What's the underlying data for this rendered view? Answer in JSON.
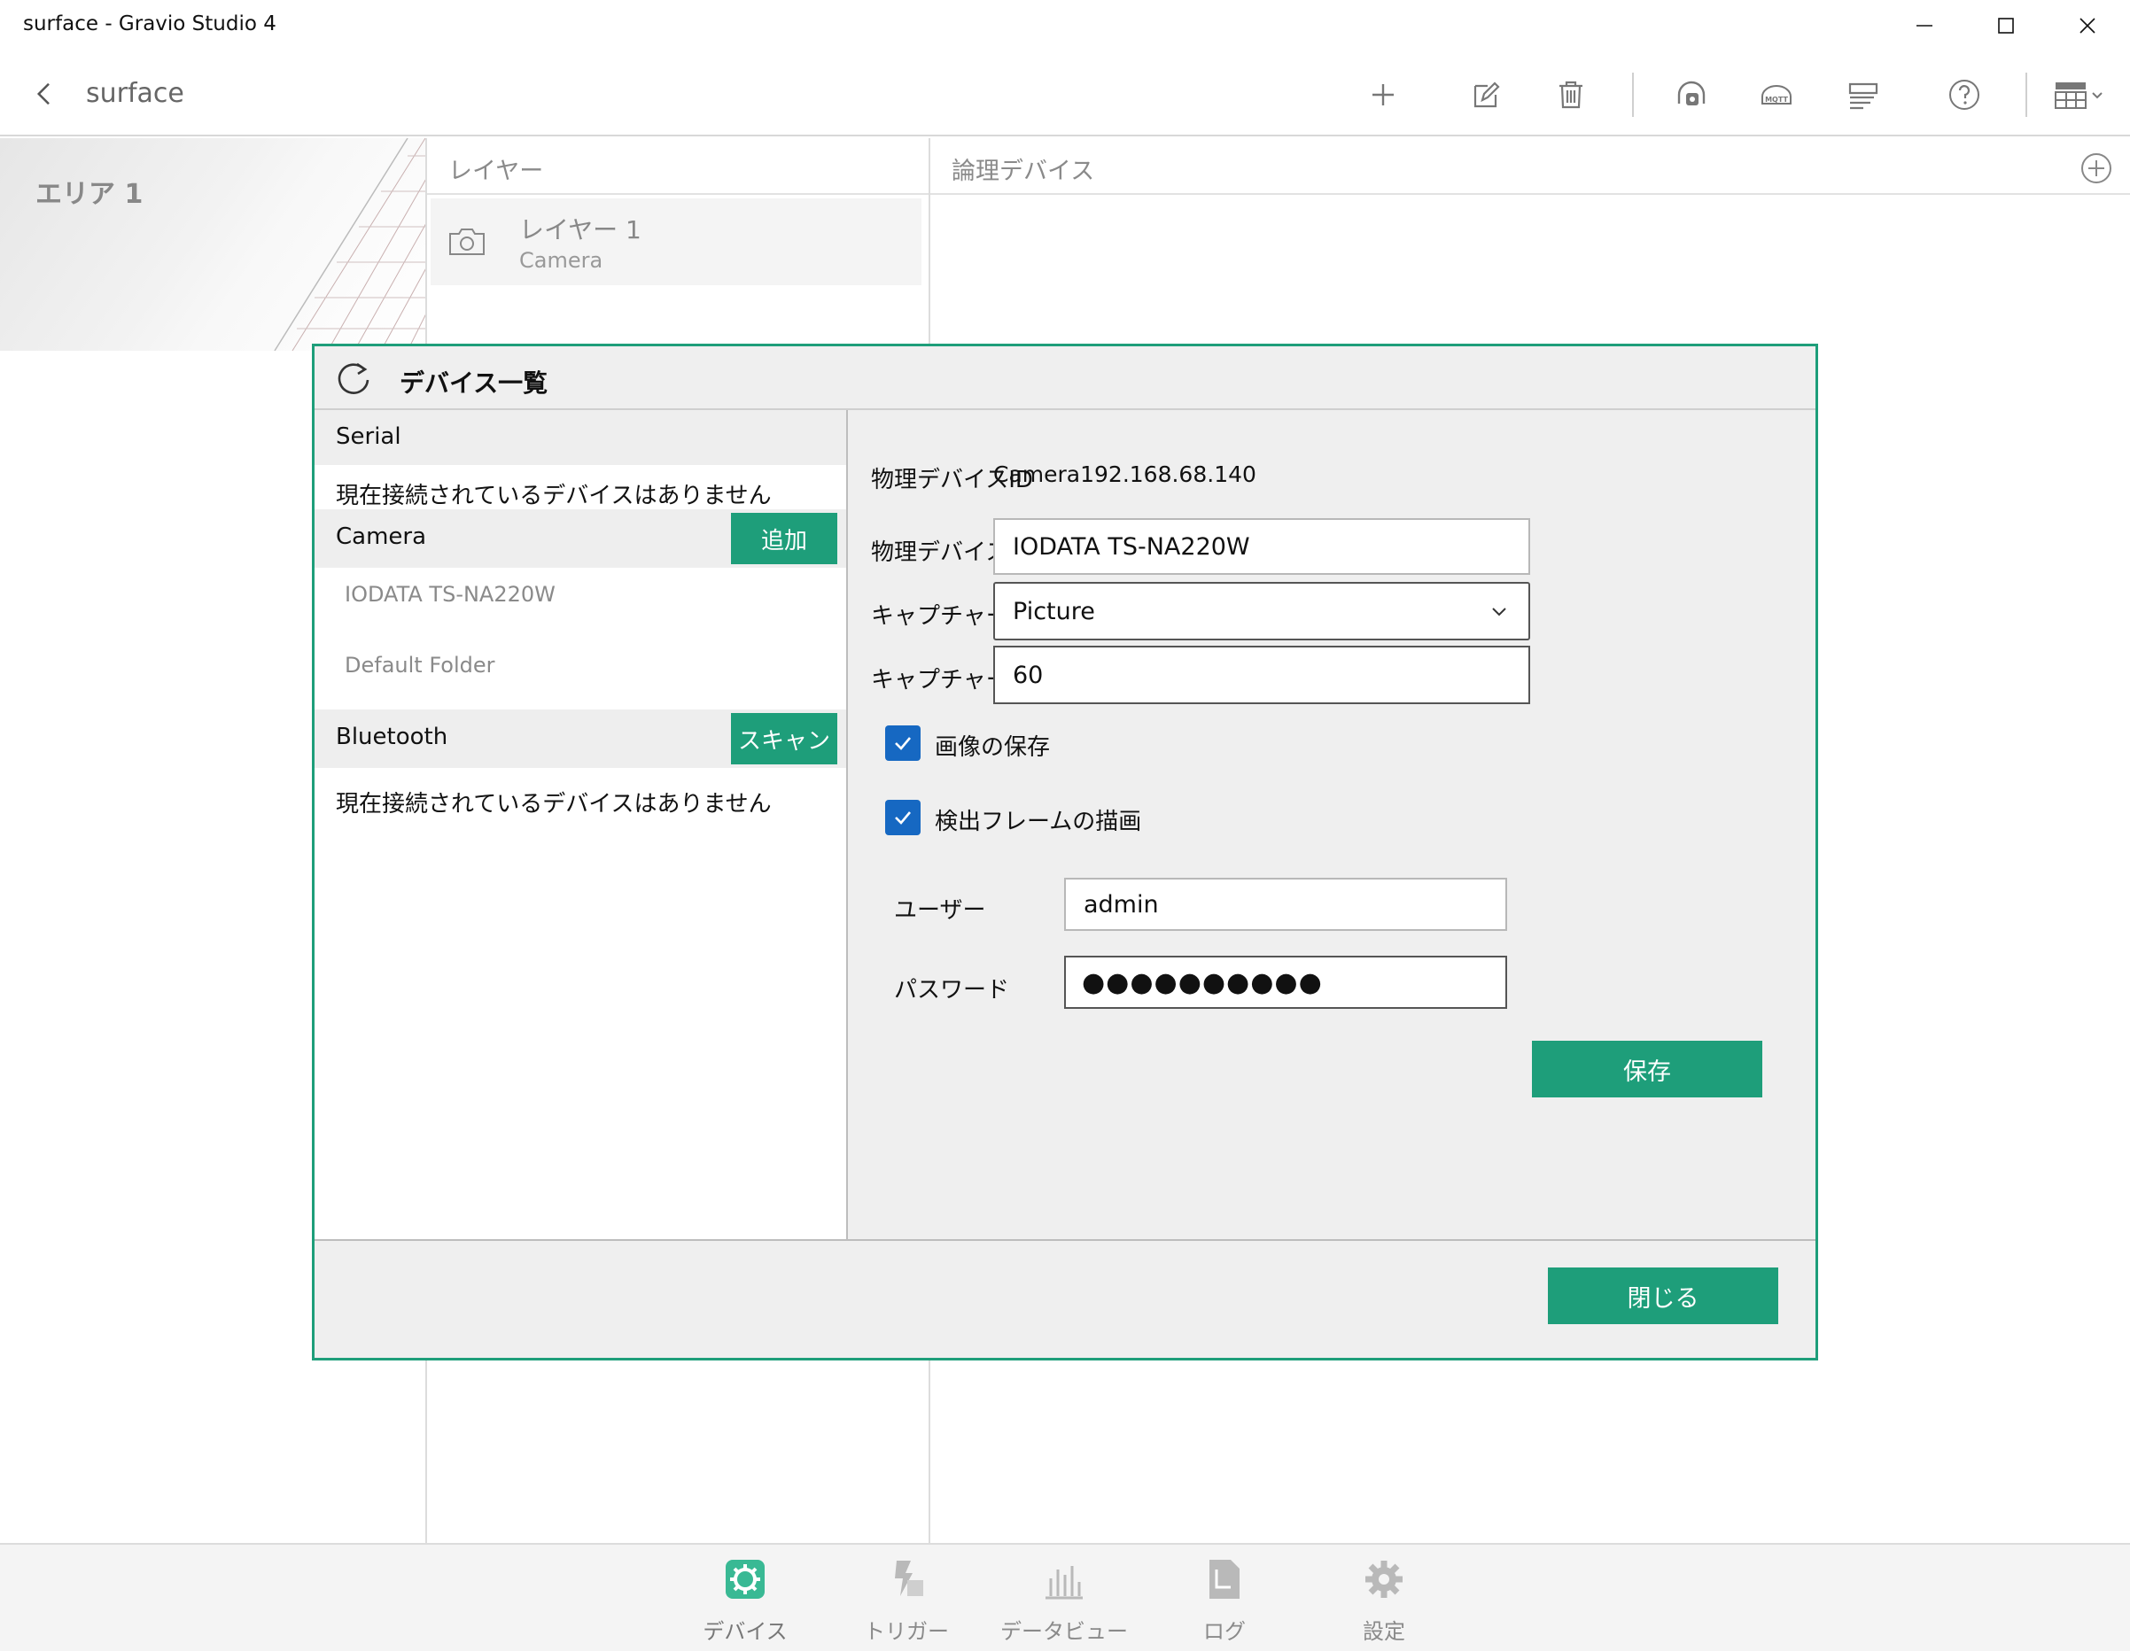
{
  "window": {
    "title": "surface - Gravio Studio 4"
  },
  "header": {
    "breadcrumb": "surface"
  },
  "toolbar": {
    "icons": [
      "add-icon",
      "edit-icon",
      "delete-icon",
      "camera-capture-icon",
      "mqtt-icon",
      "list-icon",
      "help-icon",
      "layout-icon"
    ]
  },
  "area": {
    "label": "エリア 1"
  },
  "layers": {
    "header": "レイヤー",
    "items": [
      {
        "name": "レイヤー 1",
        "type": "Camera"
      }
    ]
  },
  "logical": {
    "header": "論理デバイス"
  },
  "dialog": {
    "title": "デバイス一覧",
    "categories": {
      "serial": {
        "title": "Serial",
        "empty": "現在接続されているデバイスはありません"
      },
      "camera": {
        "title": "Camera",
        "button": "追加",
        "devices": [
          "IODATA TS-NA220W",
          "Default Folder"
        ]
      },
      "bluetooth": {
        "title": "Bluetooth",
        "button": "スキャン",
        "empty": "現在接続されているデバイスはありません"
      }
    },
    "form": {
      "device_id_label": "物理デバイスID",
      "device_id_value": "Camera192.168.68.140",
      "device_name_label": "物理デバイス名",
      "device_name_value": "IODATA TS-NA220W",
      "capture_format_label": "キャプチャー形式",
      "capture_format_value": "Picture",
      "capture_interval_label": "キャプチャー間隔",
      "capture_interval_value": "60",
      "save_image_label": "画像の保存",
      "save_image_checked": true,
      "draw_frame_label": "検出フレームの描画",
      "draw_frame_checked": true,
      "user_label": "ユーザー",
      "user_value": "admin",
      "password_label": "パスワード",
      "password_value": "●●●●●●●●●●",
      "save_button": "保存"
    },
    "close_button": "閉じる"
  },
  "bottom_nav": [
    {
      "label": "デバイス",
      "icon": "device-gear-icon",
      "active": true
    },
    {
      "label": "トリガー",
      "icon": "trigger-icon",
      "active": false
    },
    {
      "label": "データビューア",
      "icon": "bar-chart-icon",
      "active": false
    },
    {
      "label": "ログ",
      "icon": "log-document-icon",
      "active": false
    },
    {
      "label": "設定",
      "icon": "settings-gear-icon",
      "active": false
    }
  ],
  "colors": {
    "accent": "#1e9e7a",
    "checkbox": "#1668c2"
  }
}
